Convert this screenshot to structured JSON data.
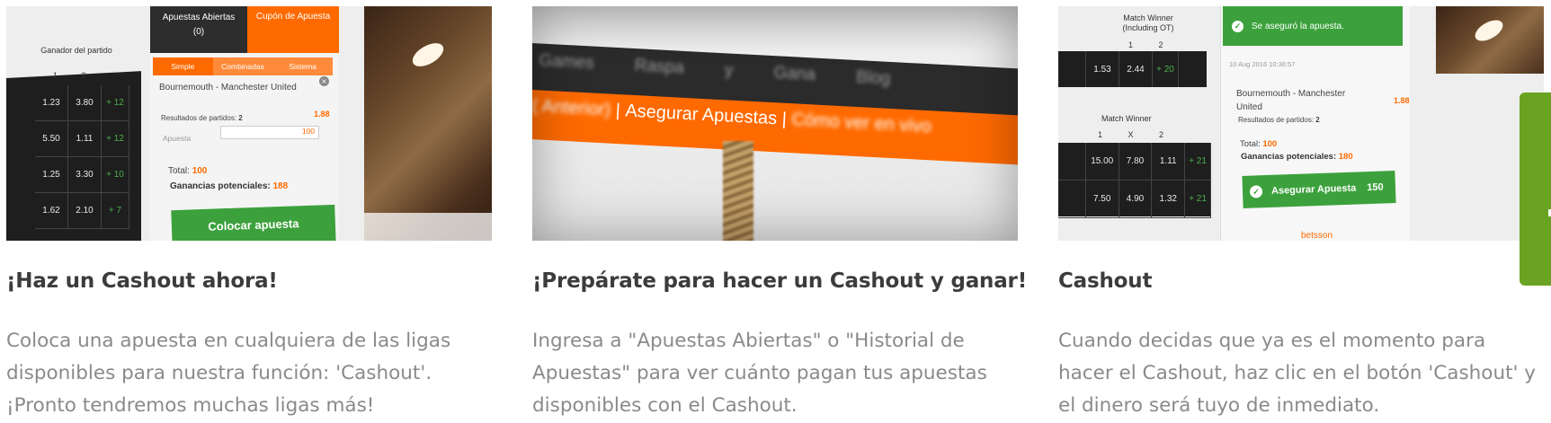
{
  "cards": [
    {
      "title": "¡Haz un Cashout ahora!",
      "body": "Coloca una apuesta en cualquiera de las ligas disponibles para nuestra función: 'Cashout'. ¡Pronto tendremos muchas ligas más!",
      "shot": {
        "header": "Ganador del partido",
        "header_cols": "1 2",
        "rows": [
          [
            "1.23",
            "3.80",
            "+ 12"
          ],
          [
            "5.50",
            "1.11",
            "+ 12"
          ],
          [
            "1.25",
            "3.30",
            "+ 10"
          ],
          [
            "1.62",
            "2.10",
            "+ 7"
          ]
        ],
        "tab_open": "Apuestas Abiertas",
        "tab_open_count": "(0)",
        "tab_coupon": "Cupón de Apuesta",
        "subtabs": [
          "Simple",
          "Combinadas",
          "Sistema"
        ],
        "match": "Bournemouth - Manchester United",
        "results_label": "Resultados de partidos:",
        "results_value": "2",
        "odd": "1.88",
        "stake_label": "Apuesta",
        "stake_value": "100",
        "total_label": "Total:",
        "total_value": "100",
        "potential_label": "Ganancias potenciales:",
        "potential_value": "188",
        "place_button": "Colocar apuesta"
      }
    },
    {
      "title": "¡Prepárate para hacer un Cashout y ganar!",
      "body": "Ingresa a \"Apuestas Abiertas\" o \"Historial de Apuestas\" para ver cuánto pagan tus apuestas disponibles con el Cashout.",
      "shot": {
        "menu": "Games Raspa y Gana Blog",
        "nav_prev": "( Anterior)",
        "nav_sep": "|",
        "nav_main": "Asegurar Apuestas",
        "nav_next": "Cómo ver en vivo"
      }
    },
    {
      "title": "Cashout",
      "body": "Cuando decidas que ya es el momento para hacer el Cashout, haz clic en el botón 'Cashout' y el dinero será tuyo de inmediato.",
      "shot": {
        "header": "Match Winner (Including OT)",
        "header_cols": "1 2",
        "row1": [
          "",
          "1.53",
          "2.44",
          "+ 20"
        ],
        "mw_header": "Match Winner",
        "mw_cols": "1 X 2",
        "rows": [
          [
            "",
            "15.00",
            "7.80",
            "1.11",
            "+ 21"
          ],
          [
            "",
            "7.50",
            "4.90",
            "1.32",
            "+ 21"
          ]
        ],
        "confirm": "Se aseguró la apuesta.",
        "date": "10 Aug 2016 10:36:57",
        "match": "Bournemouth - Manchester United",
        "results_label": "Resultados de partidos:",
        "results_value": "2",
        "odd": "1.88",
        "total_label": "Total:",
        "total_value": "100",
        "potential_label": "Ganancias potenciales:",
        "potential_value": "180",
        "cashout_button": "Asegurar Apuesta",
        "cashout_amount": "150",
        "brand": "betsson"
      }
    }
  ],
  "colors": {
    "orange": "#ff6a00",
    "green": "#3ca13c",
    "side_tab": "#6aa321",
    "title": "#3c3c3c",
    "body": "#8a8a8a"
  }
}
